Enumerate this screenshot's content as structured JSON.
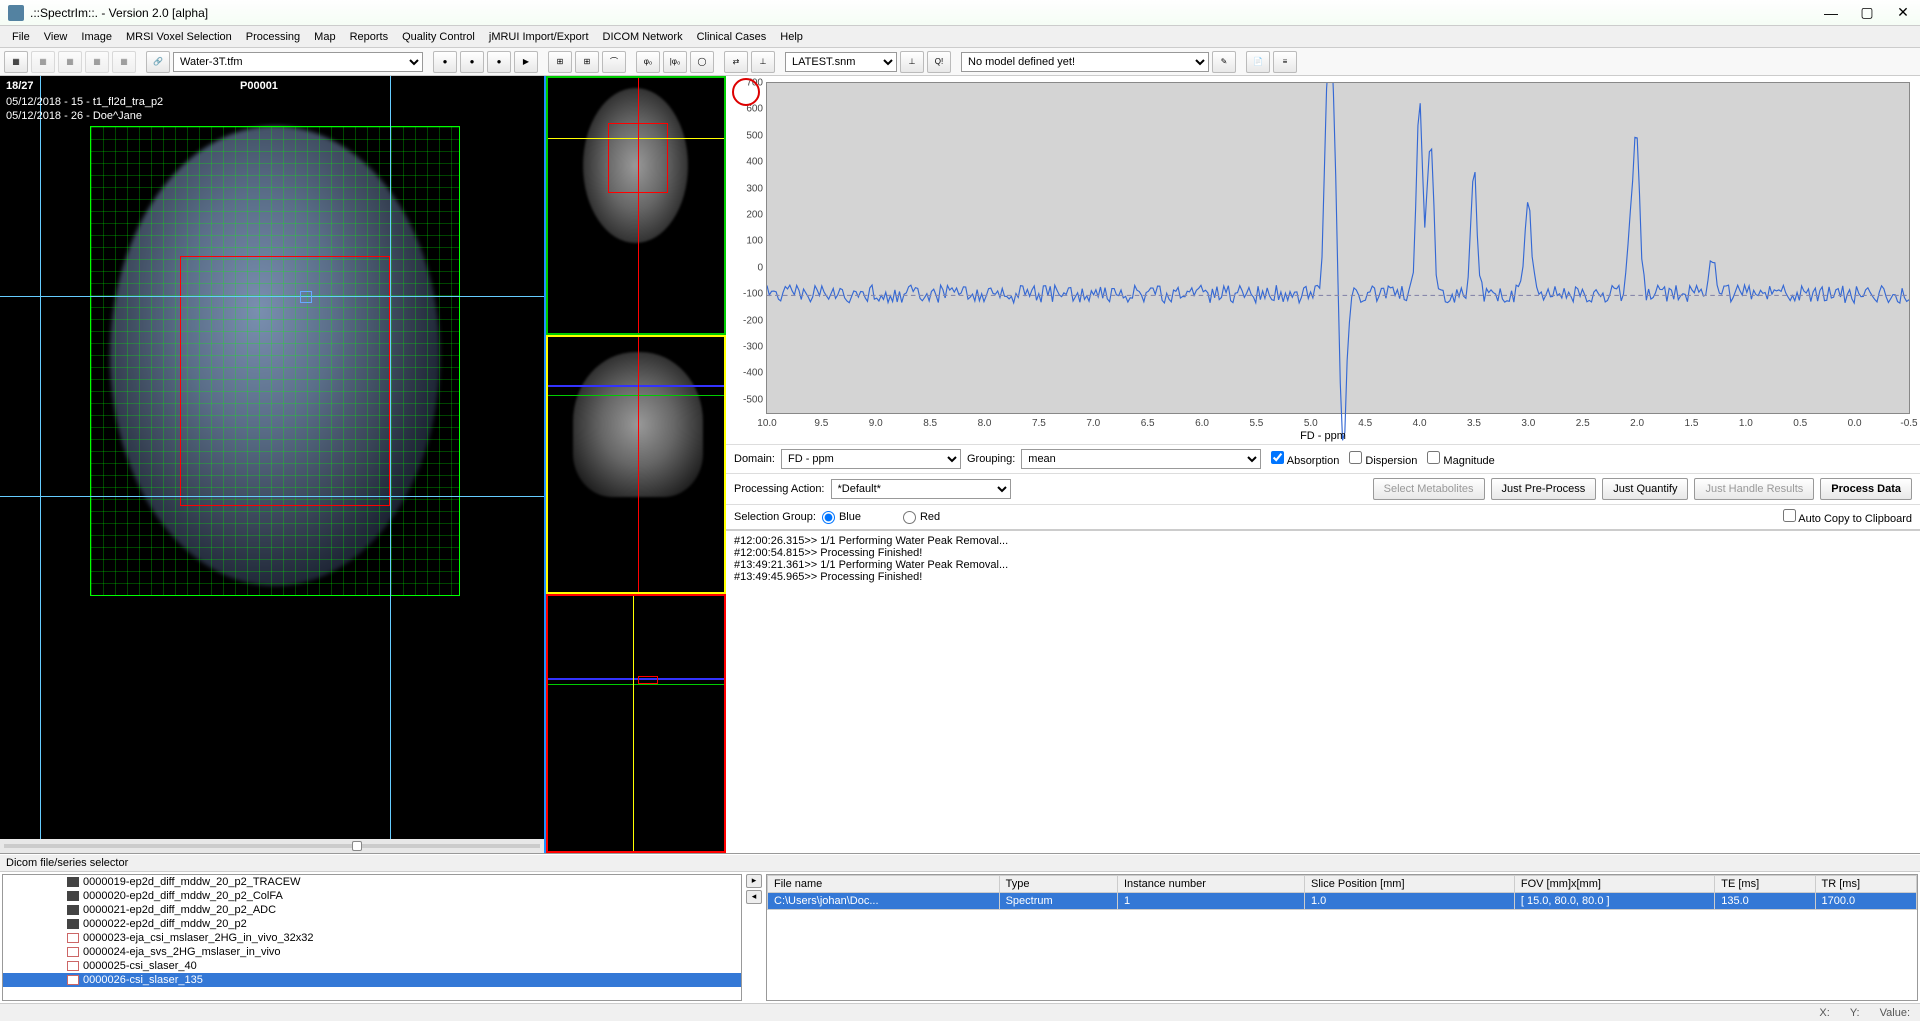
{
  "window": {
    "title": ".::SpectrIm::.    -   Version 2.0 [alpha]"
  },
  "menu": {
    "file": "File",
    "view": "View",
    "image": "Image",
    "mrsi_voxel": "MRSI Voxel Selection",
    "processing": "Processing",
    "map": "Map",
    "reports": "Reports",
    "quality": "Quality Control",
    "jmrui": "jMRUI Import/Export",
    "dicom": "DICOM Network",
    "clinical": "Clinical Cases",
    "help": "Help"
  },
  "toolbar": {
    "preset_select": "Water-3T.tfm",
    "model_select": "LATEST.snm",
    "model_status": "No model defined yet!"
  },
  "mri_overlay": {
    "slice": "18/27",
    "patient_id": "P00001",
    "line1": "05/12/2018 - 15 - t1_fl2d_tra_p2",
    "line2": "05/12/2018 - 26 - Doe^Jane"
  },
  "chart_data": {
    "type": "line",
    "title": "",
    "xlabel": "FD - ppm",
    "ylabel": "",
    "ylim": [
      -550,
      700
    ],
    "xlim": [
      10.0,
      -0.5
    ],
    "y_ticks": [
      700,
      600,
      500,
      400,
      300,
      200,
      100,
      0,
      -100,
      -200,
      -300,
      -400,
      -500
    ],
    "x_ticks": [
      10.0,
      9.5,
      9.0,
      8.5,
      8.0,
      7.5,
      7.0,
      6.5,
      6.0,
      5.5,
      5.0,
      4.5,
      4.0,
      3.5,
      3.0,
      2.5,
      2.0,
      1.5,
      1.0,
      0.5,
      0.0,
      -0.5
    ],
    "series": [
      {
        "name": "spectrum",
        "peaks": [
          {
            "ppm": 4.7,
            "intensity": -500
          },
          {
            "ppm": 4.8,
            "intensity": 650
          },
          {
            "ppm": 4.85,
            "intensity": 580
          },
          {
            "ppm": 4.0,
            "intensity": 650
          },
          {
            "ppm": 3.9,
            "intensity": 520
          },
          {
            "ppm": 3.5,
            "intensity": 400
          },
          {
            "ppm": 3.0,
            "intensity": 320
          },
          {
            "ppm": 2.0,
            "intensity": 450
          },
          {
            "ppm": 2.05,
            "intensity": 260
          },
          {
            "ppm": 1.3,
            "intensity": 130
          }
        ],
        "baseline_noise": 30
      }
    ]
  },
  "controls": {
    "domain_label": "Domain:",
    "domain_value": "FD - ppm",
    "grouping_label": "Grouping:",
    "grouping_value": "mean",
    "absorption": "Absorption",
    "dispersion": "Dispersion",
    "magnitude": "Magnitude",
    "proc_action_label": "Processing Action:",
    "proc_action_value": "*Default*",
    "sel_metab": "Select Metabolites",
    "just_pre": "Just Pre-Process",
    "just_quant": "Just Quantify",
    "just_handle": "Just Handle Results",
    "process": "Process Data",
    "sel_group_label": "Selection Group:",
    "radio_blue": "Blue",
    "radio_red": "Red",
    "auto_copy": "Auto Copy to Clipboard"
  },
  "log": [
    "#12:00:26.315>> 1/1 Performing Water Peak Removal...",
    "#12:00:54.815>> Processing Finished!",
    "#13:49:21.361>> 1/1 Performing Water Peak Removal...",
    "#13:49:45.965>> Processing Finished!"
  ],
  "bottom": {
    "title": "Dicom file/series selector",
    "tree": [
      {
        "label": "0000019-ep2d_diff_mddw_20_p2_TRACEW",
        "type": "dark",
        "cut": true
      },
      {
        "label": "0000020-ep2d_diff_mddw_20_p2_ColFA",
        "type": "dark"
      },
      {
        "label": "0000021-ep2d_diff_mddw_20_p2_ADC",
        "type": "dark"
      },
      {
        "label": "0000022-ep2d_diff_mddw_20_p2",
        "type": "dark"
      },
      {
        "label": "0000023-eja_csi_mslaser_2HG_in_vivo_32x32",
        "type": "plot"
      },
      {
        "label": "0000024-eja_svs_2HG_mslaser_in_vivo",
        "type": "plot"
      },
      {
        "label": "0000025-csi_slaser_40",
        "type": "plot"
      },
      {
        "label": "0000026-csi_slaser_135",
        "type": "plot",
        "selected": true
      }
    ],
    "table": {
      "headers": [
        "File name",
        "Type",
        "Instance number",
        "Slice Position [mm]",
        "FOV [mm]x[mm]",
        "TE [ms]",
        "TR [ms]"
      ],
      "rows": [
        {
          "cells": [
            "C:\\Users\\johan\\Doc...",
            "Spectrum",
            "1",
            "1.0",
            "[ 15.0, 80.0, 80.0 ]",
            "135.0",
            "1700.0"
          ],
          "selected": true
        }
      ]
    }
  },
  "status": {
    "x": "X:",
    "y": "Y:",
    "value": "Value:"
  }
}
